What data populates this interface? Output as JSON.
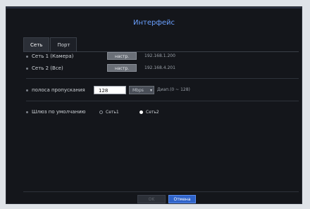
{
  "title": "Интерфейс",
  "tabs": [
    {
      "label": "Сеть",
      "active": true
    },
    {
      "label": "Порт",
      "active": false
    }
  ],
  "networks": [
    {
      "label": "Сеть 1 (Камера)",
      "button": "настр.",
      "ip": "192.168.1.200"
    },
    {
      "label": "Сеть 2 (Все)",
      "button": "настр.",
      "ip": "192.168.4.201"
    }
  ],
  "bandwidth": {
    "label": "полоса пропускания",
    "value": "128",
    "unit": "Mbps",
    "range": "Диап.(0 ~ 128)"
  },
  "gateway": {
    "label": "Шлюз по умолчанию",
    "options": [
      {
        "label": "Сеть1",
        "selected": false
      },
      {
        "label": "Сеть2",
        "selected": true
      }
    ]
  },
  "footer": {
    "ok": "OK",
    "cancel": "Отмена"
  }
}
